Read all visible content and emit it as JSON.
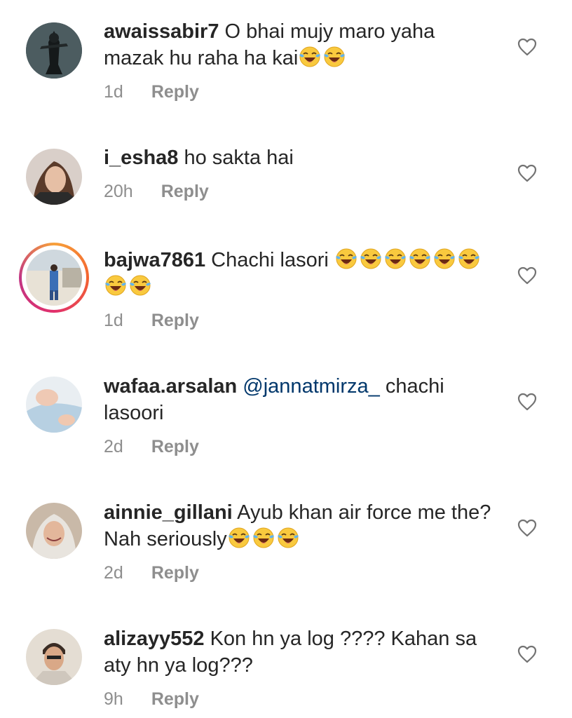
{
  "colors": {
    "text": "#262626",
    "muted": "#8e8e8e",
    "mention": "#00376b",
    "story_ring": [
      "#f7a13a",
      "#e1306c",
      "#c13584"
    ]
  },
  "comments": [
    {
      "username": "awaissabir7",
      "text": " O bhai mujy maro yaha mazak hu raha ha kai",
      "emoji_count": 2,
      "time": "1d",
      "reply_label": "Reply",
      "like_icon": "heart-outline-icon"
    },
    {
      "username": "i_esha8",
      "text": " ho sakta hai",
      "emoji_count": 0,
      "time": "20h",
      "reply_label": "Reply",
      "like_icon": "heart-outline-icon"
    },
    {
      "username": "bajwa7861",
      "text": " Chachi lasori ",
      "emoji_count": 8,
      "time": "1d",
      "reply_label": "Reply",
      "like_icon": "heart-outline-icon",
      "has_story": true
    },
    {
      "username": "wafaa.arsalan",
      "mention": "@jannatmirza_",
      "text": "  chachi lasoori",
      "emoji_count": 0,
      "time": "2d",
      "reply_label": "Reply",
      "like_icon": "heart-outline-icon"
    },
    {
      "username": "ainnie_gillani",
      "text": " Ayub khan air force me the? Nah seriously",
      "emoji_count": 3,
      "time": "2d",
      "reply_label": "Reply",
      "like_icon": "heart-outline-icon"
    },
    {
      "username": "alizayy552",
      "text": " Kon hn ya log ???? Kahan sa aty hn ya log???",
      "emoji_count": 0,
      "time": "9h",
      "reply_label": "Reply",
      "like_icon": "heart-outline-icon"
    }
  ]
}
